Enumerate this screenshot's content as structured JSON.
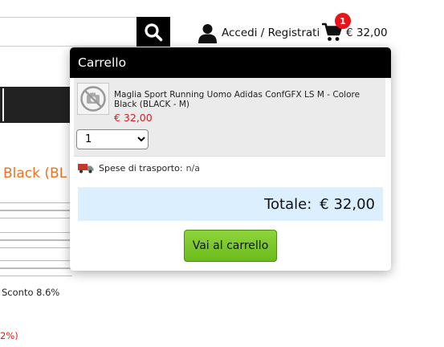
{
  "header": {
    "search": {
      "placeholder": "",
      "value": "",
      "icon": "search-icon"
    },
    "account": {
      "icon": "user-icon",
      "label": "Accedi / Registrati"
    },
    "cart": {
      "icon": "cart-icon",
      "badge_count": "1",
      "total": "€ 32,00",
      "badge_color": "#e8141a"
    }
  },
  "background": {
    "product_title_fragment": "Black (BL",
    "discount_text": "Sconto 8.6%",
    "percent_fragment": "2%)"
  },
  "cart_panel": {
    "title": "Carrello",
    "item": {
      "name": "Maglia Sport Running Uomo Adidas ConfGFX LS M - Colore Black (BLACK - M)",
      "price": "€ 32,00",
      "quantity": "1",
      "thumb_icon": "no-image-icon"
    },
    "shipping": {
      "icon": "truck-icon",
      "label": "Spese di trasporto:",
      "value": "n/a"
    },
    "total": {
      "label": "Totale:",
      "value": "€ 32,00"
    },
    "go_to_cart_label": "Vai al carrello",
    "colors": {
      "header_bg": "#000000",
      "price": "#e8141a",
      "total_bg": "#dcefff",
      "button": "#6bbb1c"
    }
  }
}
